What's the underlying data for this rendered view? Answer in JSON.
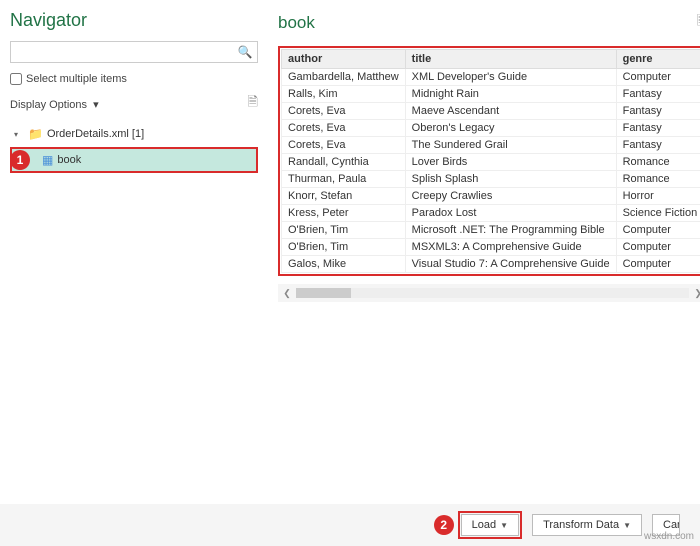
{
  "title": "Navigator",
  "search": {
    "placeholder": ""
  },
  "multiSelect": {
    "label": "Select multiple items"
  },
  "displayOptions": {
    "label": "Display Options"
  },
  "tree": {
    "root": "OrderDetails.xml [1]",
    "selected": "book"
  },
  "preview": {
    "title": "book",
    "columns": [
      "author",
      "title",
      "genre"
    ],
    "rows": [
      [
        "Gambardella, Matthew",
        "XML Developer's Guide",
        "Computer"
      ],
      [
        "Ralls, Kim",
        "Midnight Rain",
        "Fantasy"
      ],
      [
        "Corets, Eva",
        "Maeve Ascendant",
        "Fantasy"
      ],
      [
        "Corets, Eva",
        "Oberon's Legacy",
        "Fantasy"
      ],
      [
        "Corets, Eva",
        "The Sundered Grail",
        "Fantasy"
      ],
      [
        "Randall, Cynthia",
        "Lover Birds",
        "Romance"
      ],
      [
        "Thurman, Paula",
        "Splish Splash",
        "Romance"
      ],
      [
        "Knorr, Stefan",
        "Creepy Crawlies",
        "Horror"
      ],
      [
        "Kress, Peter",
        "Paradox Lost",
        "Science Fiction"
      ],
      [
        "O'Brien, Tim",
        "Microsoft .NET: The Programming Bible",
        "Computer"
      ],
      [
        "O'Brien, Tim",
        "MSXML3: A Comprehensive Guide",
        "Computer"
      ],
      [
        "Galos, Mike",
        "Visual Studio 7: A Comprehensive Guide",
        "Computer"
      ]
    ]
  },
  "footer": {
    "load": "Load",
    "transform": "Transform Data",
    "cancel": "Can"
  },
  "callouts": {
    "one": "1",
    "two": "2"
  },
  "watermark": "wsxdn.com"
}
